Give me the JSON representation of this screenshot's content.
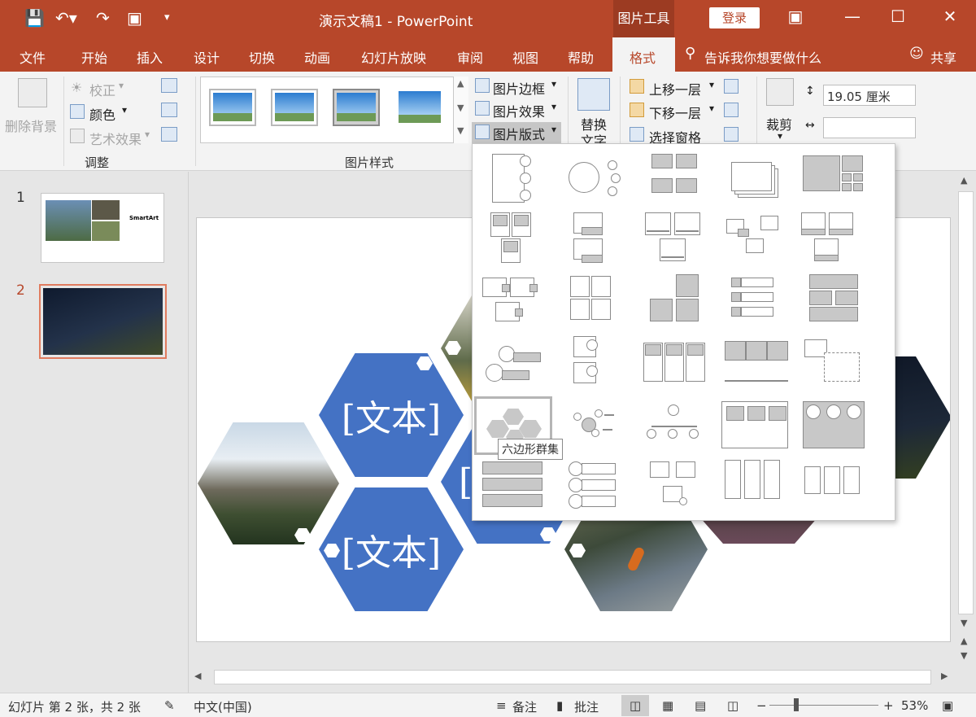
{
  "window": {
    "title": "演示文稿1  -  PowerPoint",
    "context_tab": "图片工具",
    "login_label": "登录"
  },
  "tabs": [
    "文件",
    "开始",
    "插入",
    "设计",
    "切换",
    "动画",
    "幻灯片放映",
    "审阅",
    "视图",
    "帮助",
    "格式"
  ],
  "tell_me": "告诉我你想要做什么",
  "share": "共享",
  "ribbon": {
    "remove_bg": "删除背景",
    "correct": "校正",
    "color": "颜色",
    "artistic": "艺术效果",
    "adjust_group": "调整",
    "styles_group": "图片样式",
    "border": "图片边框",
    "effects": "图片效果",
    "layout": "图片版式",
    "alt_text_1": "替换",
    "alt_text_2": "文字",
    "bring_forward": "上移一层",
    "send_backward": "下移一层",
    "selection_pane": "选择窗格",
    "crop": "裁剪",
    "height_value": "19.05 厘米",
    "width_value": ""
  },
  "slides": [
    {
      "number": "1",
      "title": "SmartArt"
    },
    {
      "number": "2"
    }
  ],
  "slide_text": {
    "hex_1": "[文本]",
    "hex_2": "[文本]",
    "hex_3_partial": "["
  },
  "tooltip": "六边形群集",
  "status": {
    "slide_info": "幻灯片 第 2 张，共 2 张",
    "language": "中文(中国)",
    "notes": "备注",
    "comments": "批注",
    "zoom": "53%"
  },
  "colors": {
    "accent": "#b7472a",
    "hex_blue": "#4472c4"
  }
}
